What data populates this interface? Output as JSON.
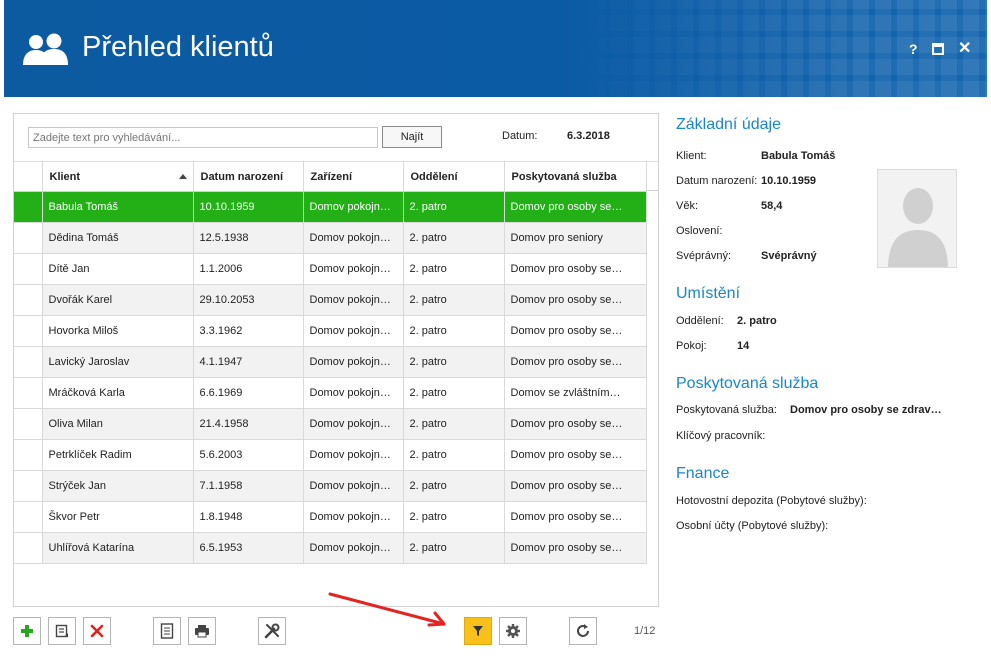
{
  "header": {
    "title": "Přehled klientů",
    "help_label": "?",
    "close_label": "✕",
    "bg_color": "#0b5aa4"
  },
  "search": {
    "placeholder": "Zadejte text pro vyhledávání...",
    "button_label": "Najít"
  },
  "date": {
    "label": "Datum:",
    "value": "6.3.2018"
  },
  "table": {
    "columns": [
      "Klient",
      "Datum narození",
      "Zařízení",
      "Oddělení",
      "Poskytovaná služba"
    ],
    "sorted_column": "Klient",
    "selected_color": "#22b016",
    "rows": [
      [
        "Babula Tomáš",
        "10.10.1959",
        "Domov pokojného…",
        "2. patro",
        "Domov pro osoby se…"
      ],
      [
        "Dědina Tomáš",
        "12.5.1938",
        "Domov pokojného…",
        "2. patro",
        "Domov pro seniory"
      ],
      [
        "Dítě Jan",
        "1.1.2006",
        "Domov pokojného…",
        "2. patro",
        "Domov pro osoby se…"
      ],
      [
        "Dvořák Karel",
        "29.10.2053",
        "Domov pokojného…",
        "2. patro",
        "Domov pro osoby se…"
      ],
      [
        "Hovorka Miloš",
        "3.3.1962",
        "Domov pokojného…",
        "2. patro",
        "Domov pro osoby se…"
      ],
      [
        "Lavický Jaroslav",
        "4.1.1947",
        "Domov pokojného…",
        "2. patro",
        "Domov pro osoby se…"
      ],
      [
        "Mráčková Karla",
        "6.6.1969",
        "Domov pokojného…",
        "2. patro",
        "Domov se zvláštním…"
      ],
      [
        "Oliva Milan",
        "21.4.1958",
        "Domov pokojného…",
        "2. patro",
        "Domov pro osoby se…"
      ],
      [
        "Petrklíček Radim",
        "5.6.2003",
        "Domov pokojného…",
        "2. patro",
        "Domov pro osoby se…"
      ],
      [
        "Strýček Jan",
        "7.1.1958",
        "Domov pokojného…",
        "2. patro",
        "Domov pro osoby se…"
      ],
      [
        "Škvor Petr",
        "1.8.1948",
        "Domov pokojného…",
        "2. patro",
        "Domov pro osoby se…"
      ],
      [
        "Uhlířová Katarína",
        "6.5.1953",
        "Domov pokojného…",
        "2. patro",
        "Domov pro osoby se…"
      ]
    ]
  },
  "toolbar": {
    "buttons": [
      "plus-icon",
      "edit-icon",
      "delete-icon",
      "document-icon",
      "print-icon",
      "tools-icon",
      "filter-icon",
      "settings-icon",
      "refresh-icon"
    ],
    "active_button": "filter-icon",
    "active_color": "#f7c11a",
    "page_counter": "1/12"
  },
  "details": {
    "basic": {
      "title": "Základní údaje",
      "klient_label": "Klient:",
      "klient_value": "Babula Tomáš",
      "birth_label": "Datum narození:",
      "birth_value": "10.10.1959",
      "age_label": "Věk:",
      "age_value": "58,4",
      "salutation_label": "Oslovení:",
      "competence_label": "Svéprávný:",
      "competence_value": "Svéprávný"
    },
    "placement": {
      "title": "Umístění",
      "dept_label": "Oddělení:",
      "dept_value": "2. patro",
      "room_label": "Pokoj:",
      "room_value": "14"
    },
    "service": {
      "title": "Poskytovaná služba",
      "service_label": "Poskytovaná služba:",
      "service_value": "Domov pro osoby se zdrav…",
      "key_worker_label": "Klíčový pracovník:"
    },
    "finance": {
      "title": "Fnance",
      "deposit_label": "Hotovostní depozita (Pobytové služby):",
      "accounts_label": "Osobní účty (Pobytové služby):"
    },
    "accent_color": "#1a86c8"
  }
}
